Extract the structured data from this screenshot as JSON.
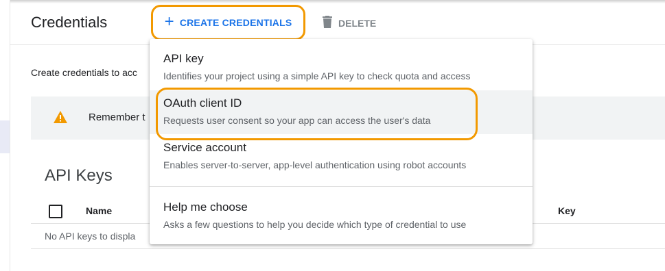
{
  "header": {
    "title": "Credentials",
    "create_label": "CREATE CREDENTIALS",
    "delete_label": "DELETE"
  },
  "intro_text": "Create credentials to acc",
  "banner": {
    "text": "Remember t"
  },
  "api_keys": {
    "title": "API Keys",
    "columns": {
      "name": "Name",
      "key": "Key"
    },
    "empty": "No API keys to displa"
  },
  "menu": {
    "items": [
      {
        "title": "API key",
        "desc": "Identifies your project using a simple API key to check quota and access"
      },
      {
        "title": "OAuth client ID",
        "desc": "Requests user consent so your app can access the user's data"
      },
      {
        "title": "Service account",
        "desc": "Enables server-to-server, app-level authentication using robot accounts"
      },
      {
        "title": "Help me choose",
        "desc": "Asks a few questions to help you decide which type of credential to use"
      }
    ]
  },
  "colors": {
    "accent": "#1a73e8",
    "highlight": "#f29900",
    "warning": "#f29900"
  },
  "icons": {
    "create": "plus-icon",
    "delete": "trash-icon",
    "banner": "warning-icon"
  }
}
